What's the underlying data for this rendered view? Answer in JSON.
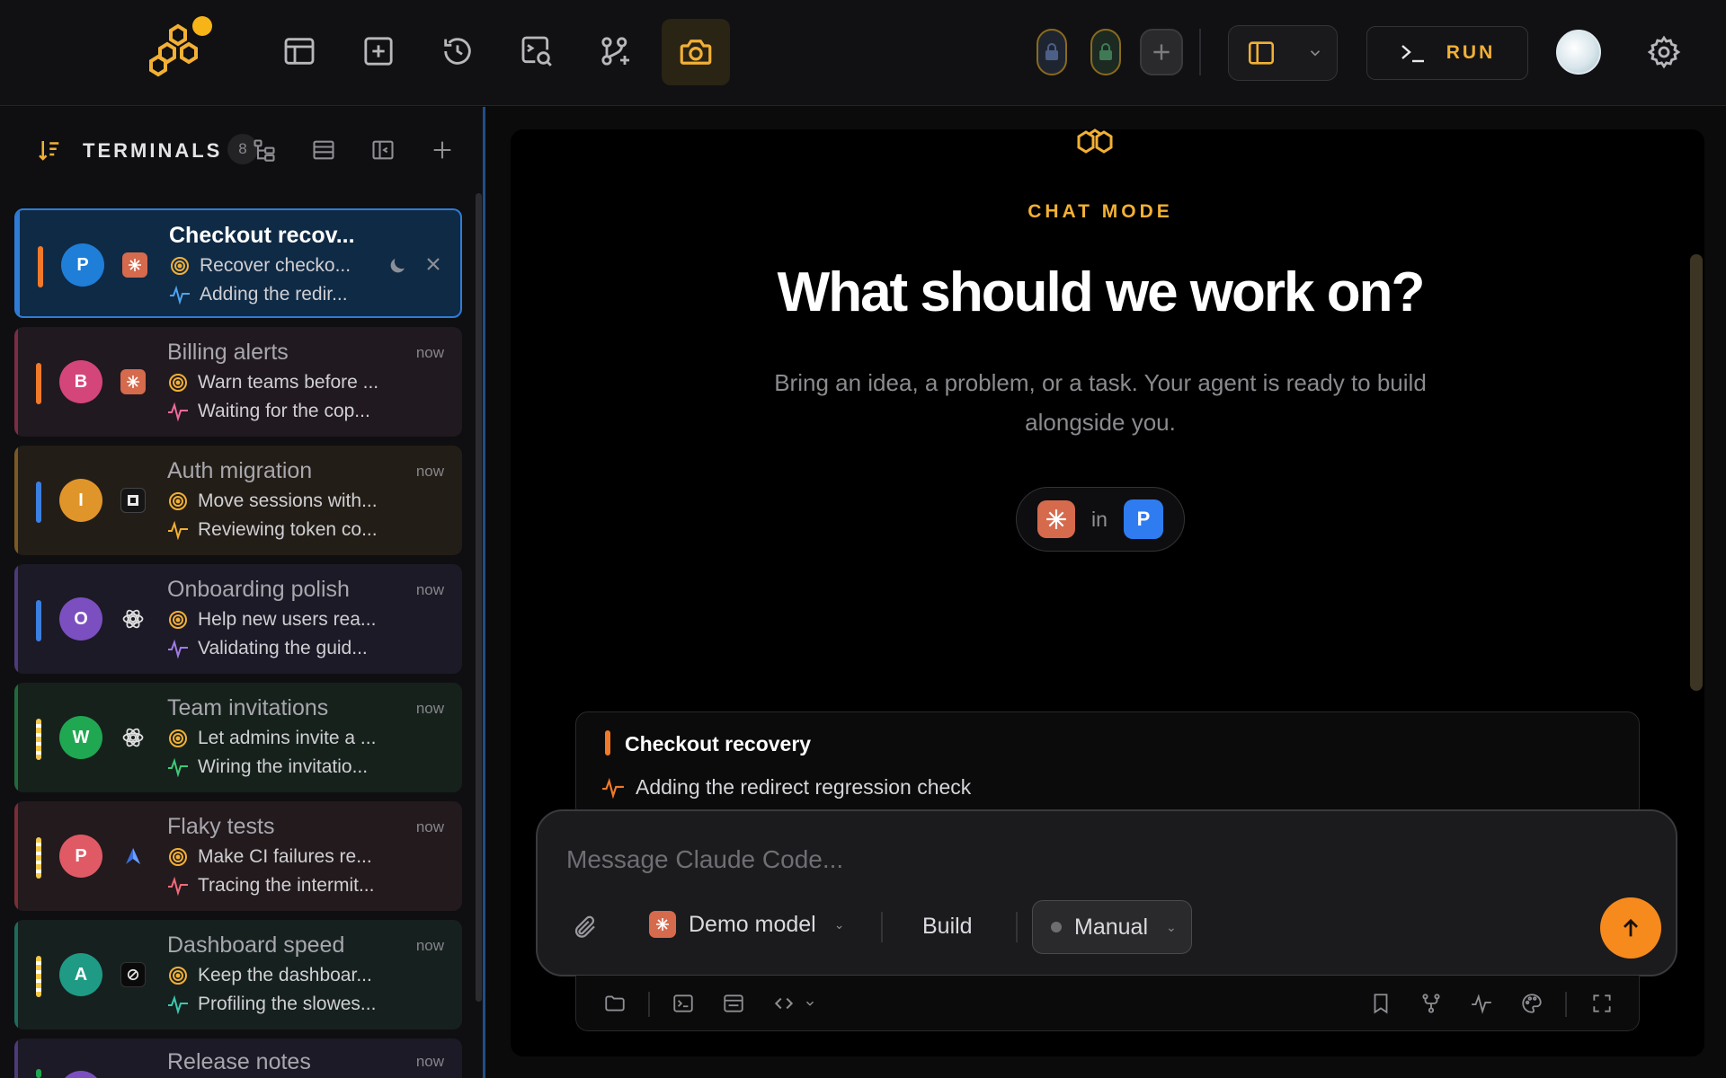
{
  "toolbar": {
    "run_label": "RUN"
  },
  "sidebar": {
    "title": "TERMINALS",
    "count": "8",
    "items": [
      {
        "title": "Checkout recov...",
        "goal": "Recover checko...",
        "status": "Adding the redir...",
        "time": "",
        "avatar": "P"
      },
      {
        "title": "Billing alerts",
        "goal": "Warn teams before ...",
        "status": "Waiting for the cop...",
        "time": "now",
        "avatar": "B"
      },
      {
        "title": "Auth migration",
        "goal": "Move sessions with...",
        "status": "Reviewing token co...",
        "time": "now",
        "avatar": "I"
      },
      {
        "title": "Onboarding polish",
        "goal": "Help new users rea...",
        "status": "Validating the guid...",
        "time": "now",
        "avatar": "O"
      },
      {
        "title": "Team invitations",
        "goal": "Let admins invite a ...",
        "status": "Wiring the invitatio...",
        "time": "now",
        "avatar": "W"
      },
      {
        "title": "Flaky tests",
        "goal": "Make CI failures re...",
        "status": "Tracing the intermit...",
        "time": "now",
        "avatar": "P"
      },
      {
        "title": "Dashboard speed",
        "goal": "Keep the dashboar...",
        "status": "Profiling the slowes...",
        "time": "now",
        "avatar": "A"
      },
      {
        "title": "Release notes",
        "goal": "",
        "status": "",
        "time": "now",
        "avatar": ""
      }
    ]
  },
  "main": {
    "mode_label": "CHAT MODE",
    "headline": "What should we work on?",
    "subtitle": "Bring an idea, a problem, or a task. Your agent is ready to build alongside you.",
    "in_label": "in",
    "project_avatar": "P",
    "context": {
      "title": "Checkout recovery",
      "status": "Adding the redirect regression check"
    },
    "composer": {
      "placeholder": "Message Claude Code...",
      "model_label": "Demo model",
      "build_label": "Build",
      "manual_label": "Manual"
    }
  },
  "colors": {
    "accent": "#f2b035",
    "send": "#f78a1d",
    "selected_border": "#2f7cd6"
  }
}
